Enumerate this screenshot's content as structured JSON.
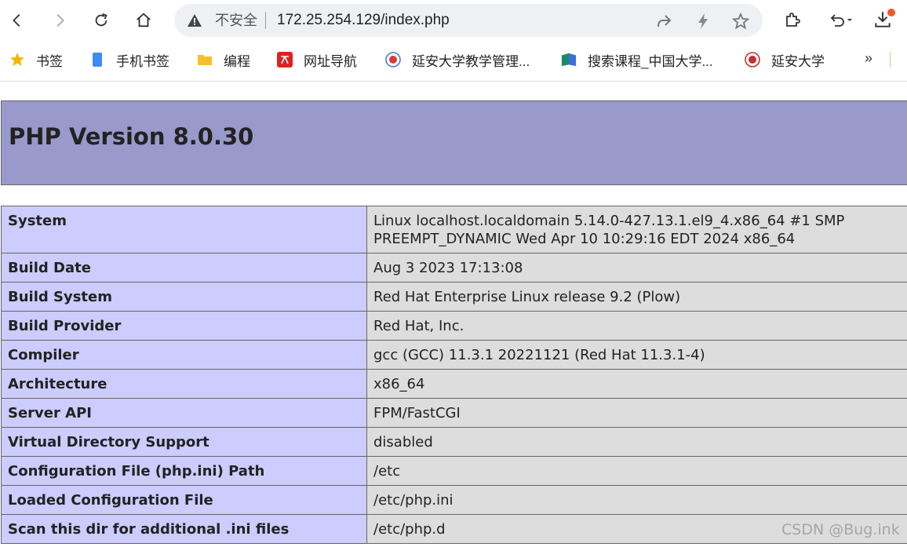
{
  "address_bar": {
    "security_label": "不安全",
    "url": "172.25.254.129/index.php"
  },
  "bookmarks": [
    {
      "label": "书签",
      "icon": "star-icon"
    },
    {
      "label": "手机书签",
      "icon": "phone-icon"
    },
    {
      "label": "编程",
      "icon": "folder-icon"
    },
    {
      "label": "网址导航",
      "icon": "site-nav-icon"
    },
    {
      "label": "延安大学教学管理...",
      "icon": "university-logo-icon"
    },
    {
      "label": "搜索课程_中国大学...",
      "icon": "mooc-icon"
    },
    {
      "label": "延安大学",
      "icon": "university-logo-icon"
    }
  ],
  "bookmarks_more": "»",
  "page": {
    "title": "PHP Version 8.0.30",
    "rows": [
      {
        "key": "System",
        "value": "Linux localhost.localdomain 5.14.0-427.13.1.el9_4.x86_64 #1 SMP PREEMPT_DYNAMIC Wed Apr 10 10:29:16 EDT 2024 x86_64"
      },
      {
        "key": "Build Date",
        "value": "Aug 3 2023 17:13:08"
      },
      {
        "key": "Build System",
        "value": "Red Hat Enterprise Linux release 9.2 (Plow)"
      },
      {
        "key": "Build Provider",
        "value": "Red Hat, Inc."
      },
      {
        "key": "Compiler",
        "value": "gcc (GCC) 11.3.1 20221121 (Red Hat 11.3.1-4)"
      },
      {
        "key": "Architecture",
        "value": "x86_64"
      },
      {
        "key": "Server API",
        "value": "FPM/FastCGI"
      },
      {
        "key": "Virtual Directory Support",
        "value": "disabled"
      },
      {
        "key": "Configuration File (php.ini) Path",
        "value": "/etc"
      },
      {
        "key": "Loaded Configuration File",
        "value": "/etc/php.ini"
      },
      {
        "key": "Scan this dir for additional .ini files",
        "value": "/etc/php.d"
      }
    ]
  },
  "watermark": "CSDN @Bug.ink",
  "colors": {
    "header_bg": "#9999cc",
    "key_bg": "#ccccff",
    "value_bg": "#dddddd",
    "badge": "#f25a27"
  }
}
